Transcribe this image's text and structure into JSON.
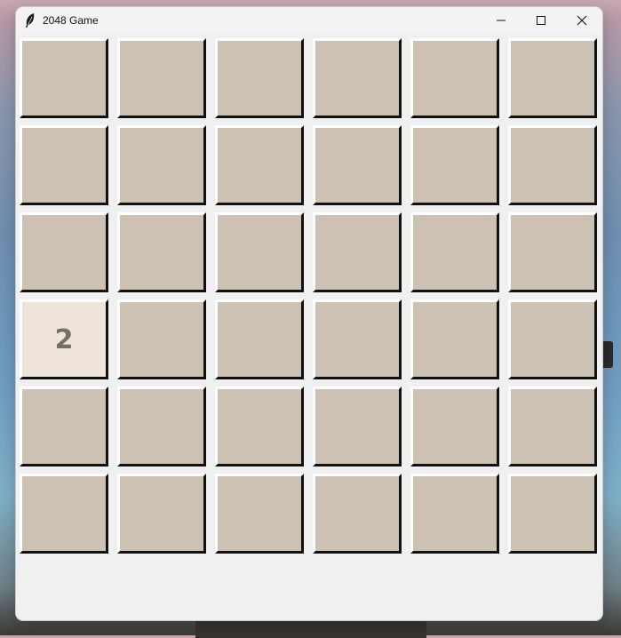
{
  "window": {
    "title": "2048 Game",
    "icon": "feather-icon",
    "controls": [
      "minimize-icon",
      "maximize-icon",
      "close-icon"
    ]
  },
  "board": {
    "rows": 6,
    "cols": 6,
    "cells": [
      [
        "",
        "",
        "",
        "",
        "",
        ""
      ],
      [
        "",
        "",
        "",
        "",
        "",
        ""
      ],
      [
        "",
        "",
        "",
        "",
        "",
        ""
      ],
      [
        "2",
        "",
        "",
        "",
        "",
        ""
      ],
      [
        "",
        "",
        "",
        "",
        "",
        ""
      ],
      [
        "",
        "",
        "",
        "",
        "",
        ""
      ]
    ]
  },
  "colors": {
    "empty_tile": "#cdc1b4",
    "tile_2": "#eee4da",
    "tile_text": "#776e65",
    "window_bg": "#f0f0f0"
  }
}
